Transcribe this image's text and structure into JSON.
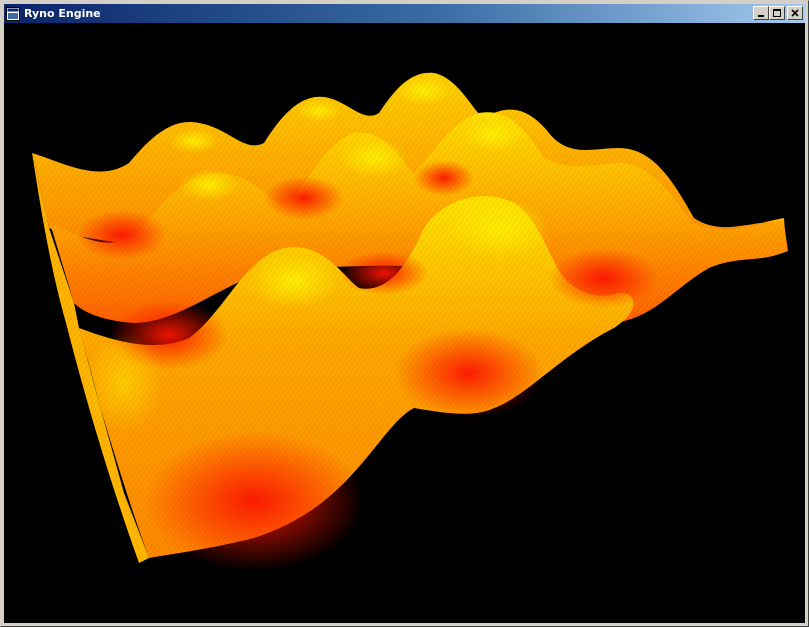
{
  "window": {
    "title": "Ryno Engine",
    "buttons": {
      "minimize": "minimize-icon",
      "maximize": "maximize-icon",
      "close": "close-icon"
    }
  },
  "viewport": {
    "background": "#000000",
    "surface_colors": {
      "peak": "#ffe600",
      "mid": "#ff9a00",
      "valley": "#ff1400"
    }
  }
}
